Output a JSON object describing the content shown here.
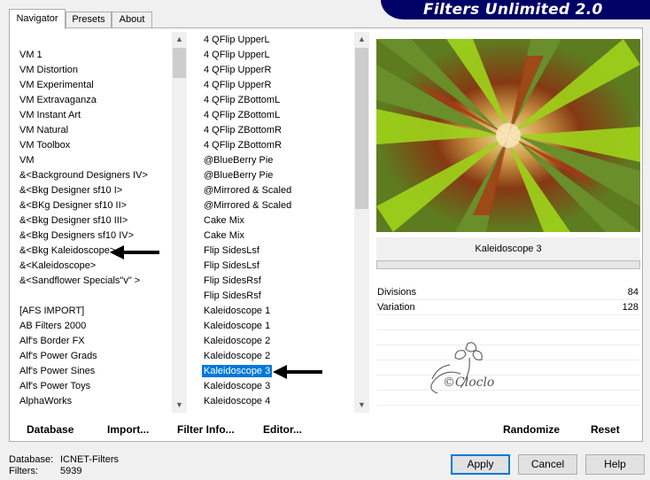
{
  "banner": {
    "title": "Filters Unlimited 2.0"
  },
  "tabs": [
    {
      "label": "Navigator",
      "active": true
    },
    {
      "label": "Presets",
      "active": false
    },
    {
      "label": "About",
      "active": false
    }
  ],
  "categories": {
    "items": [
      "VM 1",
      "VM Distortion",
      "VM Experimental",
      "VM Extravaganza",
      "VM Instant Art",
      "VM Natural",
      "VM Toolbox",
      "VM",
      "&<Background Designers IV>",
      "&<Bkg Designer sf10 I>",
      "&<BKg Designer sf10 II>",
      "&<Bkg Designer sf10 III>",
      "&<Bkg Designers sf10 IV>",
      "&<Bkg Kaleidoscope>",
      "&<Kaleidoscope>",
      "&<Sandflower Specials\"v\" >",
      "",
      "[AFS IMPORT]",
      "AB Filters 2000",
      "Alf's Border FX",
      "Alf's Power Grads",
      "Alf's Power Sines",
      "Alf's Power Toys",
      "AlphaWorks"
    ]
  },
  "filters": {
    "selected_index": 22,
    "items": [
      "4 QFlip UpperL",
      "4 QFlip UpperL",
      "4 QFlip UpperR",
      "4 QFlip UpperR",
      "4 QFlip ZBottomL",
      "4 QFlip ZBottomL",
      "4 QFlip ZBottomR",
      "4 QFlip ZBottomR",
      "@BlueBerry Pie",
      "@BlueBerry Pie",
      "@Mirrored & Scaled",
      "@Mirrored & Scaled",
      "Cake Mix",
      "Cake Mix",
      "Flip SidesLsf",
      "Flip SidesLsf",
      "Flip SidesRsf",
      "Flip SidesRsf",
      "Kaleidoscope 1",
      "Kaleidoscope 1",
      "Kaleidoscope 2",
      "Kaleidoscope 2",
      "Kaleidoscope 3",
      "Kaleidoscope 3",
      "Kaleidoscope 4"
    ]
  },
  "preview": {
    "filter_name": "Kaleidoscope 3"
  },
  "params": [
    {
      "label": "Divisions",
      "value": "84"
    },
    {
      "label": "Variation",
      "value": "128"
    }
  ],
  "watermark": {
    "text": "©Cloclo"
  },
  "toolbar": {
    "database": "Database",
    "import": "Import...",
    "filter_info": "Filter Info...",
    "editor": "Editor...",
    "randomize": "Randomize",
    "reset": "Reset"
  },
  "status": {
    "database_label": "Database:",
    "database_value": "ICNET-Filters",
    "filters_label": "Filters:",
    "filters_value": "5939"
  },
  "dialog": {
    "apply": "Apply",
    "cancel": "Cancel",
    "help": "Help"
  },
  "colors": {
    "banner": "#000066",
    "selection": "#0078d7"
  }
}
